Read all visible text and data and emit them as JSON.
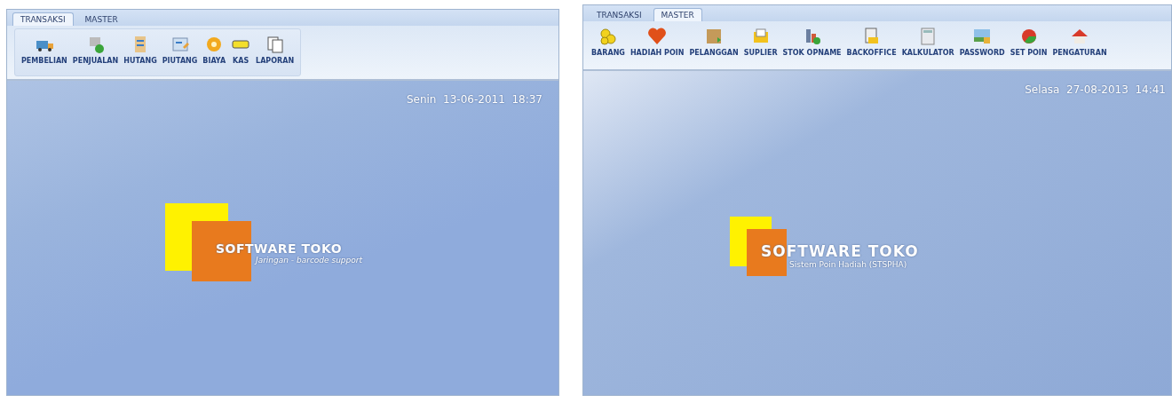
{
  "screens": [
    {
      "tabs": [
        {
          "label": "TRANSAKSI",
          "selected": true
        },
        {
          "label": "MASTER",
          "selected": false
        }
      ],
      "toolbar_grouped": true,
      "tools": [
        "PEMBELIAN",
        "PENJUALAN",
        "HUTANG",
        "PIUTANG",
        "BIAYA",
        "KAS",
        "LAPORAN"
      ],
      "datetime": "Senin  13-06-2011  18:37",
      "logo": {
        "title": "SOFTWARE TOKO",
        "subtitle": "Jaringan - barcode support"
      }
    },
    {
      "tabs": [
        {
          "label": "TRANSAKSI",
          "selected": false
        },
        {
          "label": "MASTER",
          "selected": true
        }
      ],
      "toolbar_grouped": false,
      "tools": [
        "BARANG",
        "HADIAH POIN",
        "PELANGGAN",
        "SUPLIER",
        "STOK OPNAME",
        "BACKOFFICE",
        "KALKULATOR",
        "PASSWORD",
        "SET POIN",
        "PENGATURAN"
      ],
      "datetime": "Selasa  27-08-2013  14:41",
      "logo": {
        "title": "SOFTWARE TOKO",
        "subtitle": "Sistem Poin Hadiah (STSPHA)"
      }
    }
  ]
}
